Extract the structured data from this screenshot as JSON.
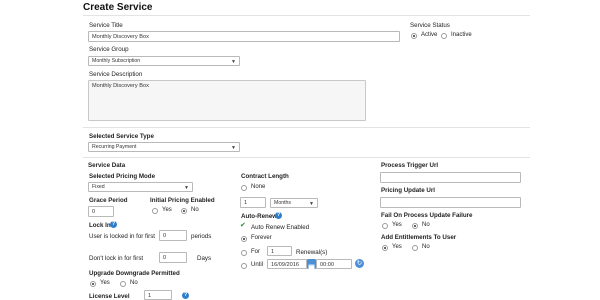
{
  "page": {
    "title": "Create Service"
  },
  "service_title": {
    "label": "Service Title",
    "value": "Monthly Discovery Box"
  },
  "service_status": {
    "label": "Service Status",
    "options": [
      "Active",
      "Inactive"
    ],
    "selected": "Active"
  },
  "service_group": {
    "label": "Service Group",
    "value": "Monthly Subscription"
  },
  "service_description": {
    "label": "Service Description",
    "value": "Monthly Discovery Box"
  },
  "selected_service_type": {
    "label": "Selected Service Type",
    "value": "Recurring Payment"
  },
  "service_data": {
    "section_label": "Service Data",
    "pricing_mode": {
      "label": "Selected Pricing Mode",
      "value": "Fixed"
    },
    "grace_period": {
      "label": "Grace Period",
      "value": "0"
    },
    "initial_pricing": {
      "label": "Initial Pricing Enabled",
      "options": [
        "Yes",
        "No"
      ],
      "selected": "No"
    },
    "lock_in": {
      "label": "Lock In",
      "locked_text": "User is locked in for first",
      "locked_value": "0",
      "locked_unit": "periods",
      "dont_lock_text": "Don't lock in for first",
      "dont_lock_value": "0",
      "dont_lock_unit": "Days"
    },
    "upgrade_downgrade": {
      "label": "Upgrade Downgrade Permitted",
      "options": [
        "Yes",
        "No"
      ],
      "selected": "Yes"
    },
    "license_level": {
      "label": "License Level",
      "value": "1"
    }
  },
  "contract": {
    "label": "Contract Length",
    "none_label": "None",
    "value": "1",
    "unit": "Months"
  },
  "auto_renew": {
    "label": "Auto-Renew",
    "enabled_label": "Auto Renew Enabled",
    "forever_label": "Forever",
    "for_label": "For",
    "for_value": "1",
    "for_unit": "Renewal(s)",
    "until_label": "Until",
    "until_date": "16/09/2016",
    "until_time": "00:00"
  },
  "right_panel": {
    "process_trigger_url": {
      "label": "Process Trigger Url",
      "value": ""
    },
    "pricing_update_url": {
      "label": "Pricing Update Url",
      "value": ""
    },
    "fail_on_update": {
      "label": "Fail On Process Update Failure",
      "options": [
        "Yes",
        "No"
      ],
      "selected": "No"
    },
    "add_entitlements": {
      "label": "Add Entitlements To User",
      "options": [
        "Yes",
        "No"
      ],
      "selected": "Yes"
    }
  },
  "icons": {
    "help": "help-icon",
    "calendar": "calendar-icon",
    "refresh": "refresh-icon",
    "check": "checkmark-icon"
  },
  "colors": {
    "accent": "#2f7fcf",
    "check": "#2e8b2e"
  }
}
